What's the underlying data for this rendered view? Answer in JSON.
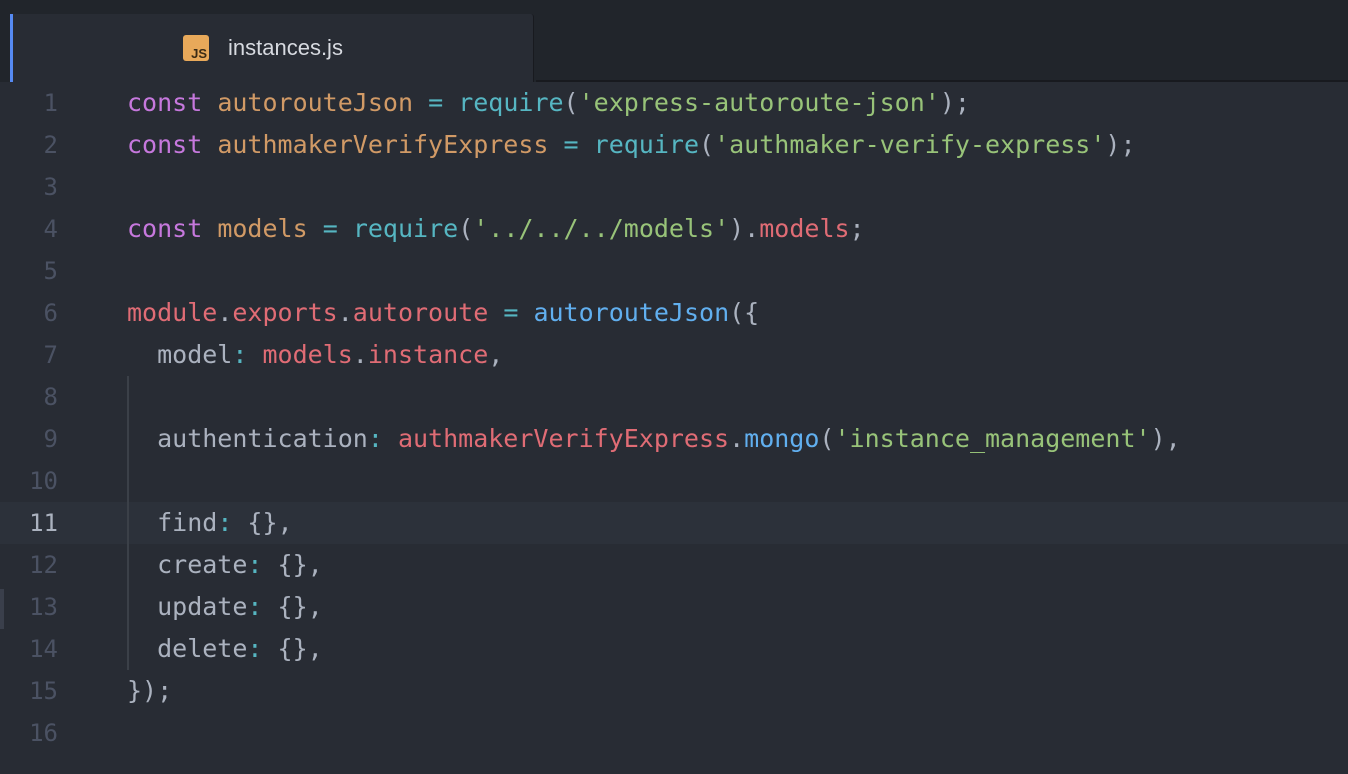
{
  "tab": {
    "title": "instances.js",
    "icon_label": "JS",
    "icon": "js-file-icon"
  },
  "colors": {
    "background": "#282c34",
    "tabbar": "#21252b",
    "accent": "#568af2",
    "keyword": "#c678dd",
    "variable": "#d19a66",
    "operator": "#56b6c2",
    "function": "#61afef",
    "string": "#98c379",
    "property": "#e06c75",
    "plain": "#abb2bf",
    "gutter": "#4b5263"
  },
  "editor": {
    "cursor_line": 11,
    "lines": [
      {
        "n": "1",
        "tokens": [
          [
            "kw",
            "const"
          ],
          [
            "pl",
            " "
          ],
          [
            "var",
            "autorouteJson"
          ],
          [
            "pl",
            " "
          ],
          [
            "op",
            "="
          ],
          [
            "pl",
            " "
          ],
          [
            "op",
            "require"
          ],
          [
            "pl",
            "("
          ],
          [
            "str",
            "'express-autoroute-json'"
          ],
          [
            "pl",
            ");"
          ]
        ]
      },
      {
        "n": "2",
        "tokens": [
          [
            "kw",
            "const"
          ],
          [
            "pl",
            " "
          ],
          [
            "var",
            "authmakerVerifyExpress"
          ],
          [
            "pl",
            " "
          ],
          [
            "op",
            "="
          ],
          [
            "pl",
            " "
          ],
          [
            "op",
            "require"
          ],
          [
            "pl",
            "("
          ],
          [
            "str",
            "'authmaker-verify-express'"
          ],
          [
            "pl",
            ");"
          ]
        ]
      },
      {
        "n": "3",
        "tokens": []
      },
      {
        "n": "4",
        "tokens": [
          [
            "kw",
            "const"
          ],
          [
            "pl",
            " "
          ],
          [
            "var",
            "models"
          ],
          [
            "pl",
            " "
          ],
          [
            "op",
            "="
          ],
          [
            "pl",
            " "
          ],
          [
            "op",
            "require"
          ],
          [
            "pl",
            "("
          ],
          [
            "str",
            "'../../../models'"
          ],
          [
            "pl",
            ")."
          ],
          [
            "prop",
            "models"
          ],
          [
            "pl",
            ";"
          ]
        ]
      },
      {
        "n": "5",
        "tokens": []
      },
      {
        "n": "6",
        "tokens": [
          [
            "prop",
            "module"
          ],
          [
            "pl",
            "."
          ],
          [
            "prop",
            "exports"
          ],
          [
            "pl",
            "."
          ],
          [
            "prop",
            "autoroute"
          ],
          [
            "pl",
            " "
          ],
          [
            "op",
            "="
          ],
          [
            "pl",
            " "
          ],
          [
            "fn",
            "autorouteJson"
          ],
          [
            "pl",
            "({"
          ]
        ]
      },
      {
        "n": "7",
        "tokens": [
          [
            "pl",
            "  model"
          ],
          [
            "op",
            ":"
          ],
          [
            "pl",
            " "
          ],
          [
            "prop",
            "models"
          ],
          [
            "pl",
            "."
          ],
          [
            "prop",
            "instance"
          ],
          [
            "pl",
            ","
          ]
        ]
      },
      {
        "n": "8",
        "tokens": []
      },
      {
        "n": "9",
        "tokens": [
          [
            "pl",
            "  authentication"
          ],
          [
            "op",
            ":"
          ],
          [
            "pl",
            " "
          ],
          [
            "prop",
            "authmakerVerifyExpress"
          ],
          [
            "pl",
            "."
          ],
          [
            "fn",
            "mongo"
          ],
          [
            "pl",
            "("
          ],
          [
            "str",
            "'instance_management'"
          ],
          [
            "pl",
            "),"
          ]
        ]
      },
      {
        "n": "10",
        "tokens": []
      },
      {
        "n": "11",
        "tokens": [
          [
            "pl",
            "  find"
          ],
          [
            "op",
            ":"
          ],
          [
            "pl",
            " {},"
          ]
        ]
      },
      {
        "n": "12",
        "tokens": [
          [
            "pl",
            "  create"
          ],
          [
            "op",
            ":"
          ],
          [
            "pl",
            " {},"
          ]
        ]
      },
      {
        "n": "13",
        "tokens": [
          [
            "pl",
            "  update"
          ],
          [
            "op",
            ":"
          ],
          [
            "pl",
            " {},"
          ]
        ]
      },
      {
        "n": "14",
        "tokens": [
          [
            "pl",
            "  delete"
          ],
          [
            "op",
            ":"
          ],
          [
            "pl",
            " {},"
          ]
        ]
      },
      {
        "n": "15",
        "tokens": [
          [
            "pl",
            "});"
          ]
        ]
      },
      {
        "n": "16",
        "tokens": []
      }
    ]
  }
}
